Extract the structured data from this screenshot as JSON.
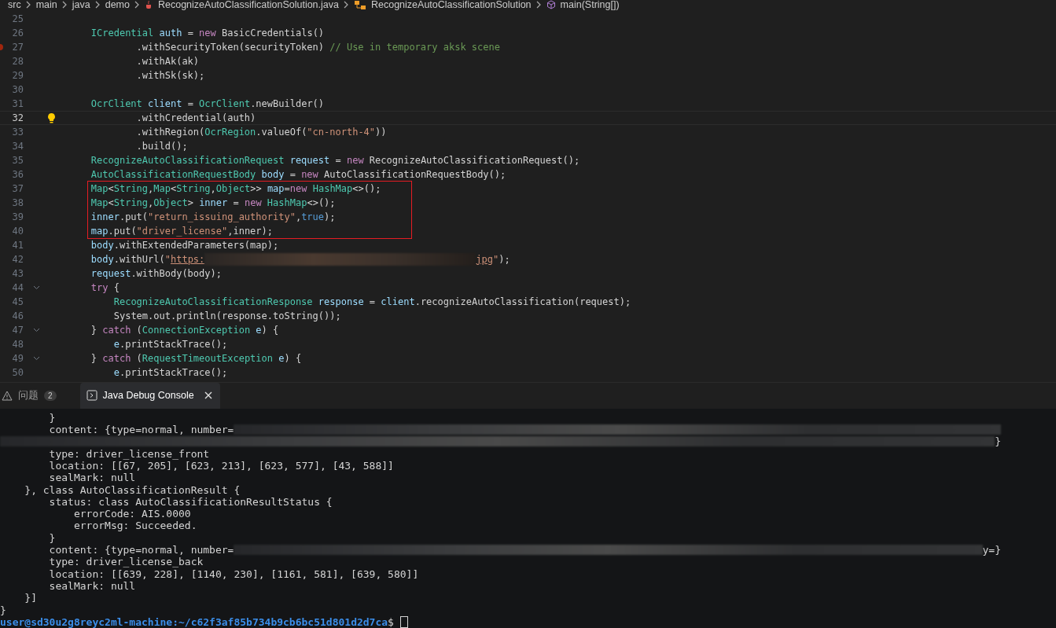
{
  "breadcrumb": [
    {
      "kind": "folder",
      "label": "src"
    },
    {
      "kind": "folder",
      "label": "main"
    },
    {
      "kind": "folder",
      "label": "java"
    },
    {
      "kind": "folder",
      "label": "demo"
    },
    {
      "kind": "file",
      "label": "RecognizeAutoClassificationSolution.java"
    },
    {
      "kind": "class",
      "label": "RecognizeAutoClassificationSolution"
    },
    {
      "kind": "method",
      "label": "main(String[])"
    }
  ],
  "editor": {
    "lines": [
      {
        "kind": "line",
        "number": "25",
        "current": false
      },
      {
        "kind": "line",
        "number": "26",
        "current": false,
        "tokens": [
          {
            "kind": "type",
            "text": "        ICredential"
          },
          {
            "kind": "var",
            "text": " auth"
          },
          {
            "kind": "plain",
            "text": " = "
          },
          {
            "kind": "keyword",
            "text": "new"
          },
          {
            "kind": "plain",
            "text": " BasicCredentials()"
          }
        ]
      },
      {
        "kind": "breakpoint",
        "number": "27",
        "current": false,
        "tokens": [
          {
            "kind": "plain",
            "text": "                .withSecurityToken(securityToken) "
          },
          {
            "kind": "comment",
            "text": "// Use in temporary aksk scene"
          }
        ]
      },
      {
        "kind": "line",
        "number": "28",
        "current": false,
        "tokens": [
          {
            "kind": "plain",
            "text": "                .withAk(ak)"
          }
        ]
      },
      {
        "kind": "line",
        "number": "29",
        "current": false,
        "tokens": [
          {
            "kind": "plain",
            "text": "                .withSk(sk);"
          }
        ]
      },
      {
        "kind": "line",
        "number": "30",
        "current": false
      },
      {
        "kind": "line",
        "number": "31",
        "current": false,
        "tokens": [
          {
            "kind": "type",
            "text": "        OcrClient"
          },
          {
            "kind": "var",
            "text": " client"
          },
          {
            "kind": "plain",
            "text": " = "
          },
          {
            "kind": "type",
            "text": "OcrClient"
          },
          {
            "kind": "plain",
            "text": ".newBuilder()"
          }
        ]
      },
      {
        "kind": "lightbulb",
        "number": "32",
        "current": true,
        "tokens": [
          {
            "kind": "plain",
            "text": "                .withCredential(auth)"
          }
        ]
      },
      {
        "kind": "line",
        "number": "33",
        "current": false,
        "tokens": [
          {
            "kind": "plain",
            "text": "                .withRegion("
          },
          {
            "kind": "type",
            "text": "OcrRegion"
          },
          {
            "kind": "plain",
            "text": ".valueOf("
          },
          {
            "kind": "string",
            "text": "\"cn-north-4\""
          },
          {
            "kind": "plain",
            "text": "))"
          }
        ]
      },
      {
        "kind": "line",
        "number": "34",
        "current": false,
        "tokens": [
          {
            "kind": "plain",
            "text": "                .build();"
          }
        ]
      },
      {
        "kind": "line",
        "number": "35",
        "current": false,
        "tokens": [
          {
            "kind": "type",
            "text": "        RecognizeAutoClassificationRequest"
          },
          {
            "kind": "var",
            "text": " request"
          },
          {
            "kind": "plain",
            "text": " = "
          },
          {
            "kind": "keyword",
            "text": "new"
          },
          {
            "kind": "plain",
            "text": " RecognizeAutoClassificationRequest();"
          }
        ]
      },
      {
        "kind": "line",
        "number": "36",
        "current": false,
        "tokens": [
          {
            "kind": "type",
            "text": "        AutoClassificationRequestBody"
          },
          {
            "kind": "var",
            "text": " body"
          },
          {
            "kind": "plain",
            "text": " = "
          },
          {
            "kind": "keyword",
            "text": "new"
          },
          {
            "kind": "plain",
            "text": " AutoClassificationRequestBody();"
          }
        ]
      },
      {
        "kind": "box",
        "lines": [
          {
            "kind": "line",
            "number": "37",
            "current": false,
            "tokens": [
              {
                "kind": "type",
                "text": "        Map"
              },
              {
                "kind": "plain",
                "text": "<"
              },
              {
                "kind": "type",
                "text": "String"
              },
              {
                "kind": "plain",
                "text": ","
              },
              {
                "kind": "type",
                "text": "Map"
              },
              {
                "kind": "plain",
                "text": "<"
              },
              {
                "kind": "type",
                "text": "String"
              },
              {
                "kind": "plain",
                "text": ","
              },
              {
                "kind": "type",
                "text": "Object"
              },
              {
                "kind": "plain",
                "text": ">> "
              },
              {
                "kind": "var",
                "text": "map"
              },
              {
                "kind": "plain",
                "text": "="
              },
              {
                "kind": "keyword",
                "text": "new"
              },
              {
                "kind": "type",
                "text": " HashMap"
              },
              {
                "kind": "plain",
                "text": "<>();"
              }
            ]
          },
          {
            "kind": "line",
            "number": "38",
            "current": false,
            "tokens": [
              {
                "kind": "type",
                "text": "        Map"
              },
              {
                "kind": "plain",
                "text": "<"
              },
              {
                "kind": "type",
                "text": "String"
              },
              {
                "kind": "plain",
                "text": ","
              },
              {
                "kind": "type",
                "text": "Object"
              },
              {
                "kind": "plain",
                "text": "> "
              },
              {
                "kind": "var",
                "text": "inner"
              },
              {
                "kind": "plain",
                "text": " = "
              },
              {
                "kind": "keyword",
                "text": "new"
              },
              {
                "kind": "type",
                "text": " HashMap"
              },
              {
                "kind": "plain",
                "text": "<>();"
              }
            ]
          },
          {
            "kind": "line",
            "number": "39",
            "current": false,
            "tokens": [
              {
                "kind": "var",
                "text": "        inner"
              },
              {
                "kind": "plain",
                "text": ".put("
              },
              {
                "kind": "string",
                "text": "\"return_issuing_authority\""
              },
              {
                "kind": "plain",
                "text": ","
              },
              {
                "kind": "literal",
                "text": "true"
              },
              {
                "kind": "plain",
                "text": ");"
              }
            ]
          },
          {
            "kind": "line",
            "number": "40",
            "current": false,
            "tokens": [
              {
                "kind": "var",
                "text": "        map"
              },
              {
                "kind": "plain",
                "text": ".put("
              },
              {
                "kind": "string",
                "text": "\"driver_license\""
              },
              {
                "kind": "plain",
                "text": ",inner);"
              }
            ]
          }
        ]
      },
      {
        "kind": "line",
        "number": "41",
        "current": false,
        "tokens": [
          {
            "kind": "var",
            "text": "        body"
          },
          {
            "kind": "plain",
            "text": ".withExtendedParameters(map);"
          }
        ]
      },
      {
        "kind": "line",
        "number": "42",
        "current": false,
        "tokens": [
          {
            "kind": "var",
            "text": "        body"
          },
          {
            "kind": "plain",
            "text": ".withUrl("
          },
          {
            "kind": "string",
            "text": "\""
          },
          {
            "kind": "link",
            "text": "https:"
          },
          {
            "kind": "redacted"
          },
          {
            "kind": "link",
            "text": "jpg"
          },
          {
            "kind": "string",
            "text": "\""
          },
          {
            "kind": "plain",
            "text": ");"
          }
        ]
      },
      {
        "kind": "line",
        "number": "43",
        "current": false,
        "tokens": [
          {
            "kind": "var",
            "text": "        request"
          },
          {
            "kind": "plain",
            "text": ".withBody(body);"
          }
        ]
      },
      {
        "kind": "fold",
        "number": "44",
        "current": false,
        "tokens": [
          {
            "kind": "keyword",
            "text": "        try"
          },
          {
            "kind": "plain",
            "text": " {"
          }
        ]
      },
      {
        "kind": "line",
        "number": "45",
        "current": false,
        "tokens": [
          {
            "kind": "type",
            "text": "            RecognizeAutoClassificationResponse"
          },
          {
            "kind": "var",
            "text": " response"
          },
          {
            "kind": "plain",
            "text": " = "
          },
          {
            "kind": "var",
            "text": "client"
          },
          {
            "kind": "plain",
            "text": ".recognizeAutoClassification(request);"
          }
        ]
      },
      {
        "kind": "line",
        "number": "46",
        "current": false,
        "tokens": [
          {
            "kind": "plain",
            "text": "            System.out.println(response.toString());"
          }
        ]
      },
      {
        "kind": "fold",
        "number": "47",
        "current": false,
        "tokens": [
          {
            "kind": "plain",
            "text": "        } "
          },
          {
            "kind": "keyword",
            "text": "catch"
          },
          {
            "kind": "plain",
            "text": " ("
          },
          {
            "kind": "type",
            "text": "ConnectionException"
          },
          {
            "kind": "var",
            "text": " e"
          },
          {
            "kind": "plain",
            "text": ") {"
          }
        ]
      },
      {
        "kind": "line",
        "number": "48",
        "current": false,
        "tokens": [
          {
            "kind": "var",
            "text": "            e"
          },
          {
            "kind": "plain",
            "text": ".printStackTrace();"
          }
        ]
      },
      {
        "kind": "fold",
        "number": "49",
        "current": false,
        "tokens": [
          {
            "kind": "plain",
            "text": "        } "
          },
          {
            "kind": "keyword",
            "text": "catch"
          },
          {
            "kind": "plain",
            "text": " ("
          },
          {
            "kind": "type",
            "text": "RequestTimeoutException"
          },
          {
            "kind": "var",
            "text": " e"
          },
          {
            "kind": "plain",
            "text": ") {"
          }
        ]
      },
      {
        "kind": "line",
        "number": "50",
        "current": false,
        "tokens": [
          {
            "kind": "var",
            "text": "            e"
          },
          {
            "kind": "plain",
            "text": ".printStackTrace();"
          }
        ]
      }
    ]
  },
  "panel": {
    "tabs": [
      {
        "kind": "problems",
        "label": "问题",
        "badge": "2",
        "selected": false
      },
      {
        "kind": "console",
        "label": "Java Debug Console",
        "selected": true
      }
    ],
    "console": [
      {
        "kind": "output",
        "tokens": [
          {
            "kind": "text",
            "text": "        }"
          }
        ]
      },
      {
        "kind": "output",
        "tokens": [
          {
            "kind": "text",
            "text": "        content: {type=normal, number="
          },
          {
            "kind": "redacted"
          }
        ]
      },
      {
        "kind": "output",
        "tokens": [
          {
            "kind": "redacted"
          },
          {
            "kind": "text",
            "text": "}"
          }
        ]
      },
      {
        "kind": "output",
        "tokens": [
          {
            "kind": "text",
            "text": "        type: driver_license_front"
          }
        ]
      },
      {
        "kind": "output",
        "tokens": [
          {
            "kind": "text",
            "text": "        location: [[67, 205], [623, 213], [623, 577], [43, 588]]"
          }
        ]
      },
      {
        "kind": "output",
        "tokens": [
          {
            "kind": "text",
            "text": "        sealMark: null"
          }
        ]
      },
      {
        "kind": "output",
        "tokens": [
          {
            "kind": "text",
            "text": "    }, class AutoClassificationResult {"
          }
        ]
      },
      {
        "kind": "output",
        "tokens": [
          {
            "kind": "text",
            "text": "        status: class AutoClassificationResultStatus {"
          }
        ]
      },
      {
        "kind": "output",
        "tokens": [
          {
            "kind": "text",
            "text": "            errorCode: AIS.0000"
          }
        ]
      },
      {
        "kind": "output",
        "tokens": [
          {
            "kind": "text",
            "text": "            errorMsg: Succeeded."
          }
        ]
      },
      {
        "kind": "output",
        "tokens": [
          {
            "kind": "text",
            "text": "        }"
          }
        ]
      },
      {
        "kind": "output",
        "tokens": [
          {
            "kind": "text",
            "text": "        content: {type=normal, number="
          },
          {
            "kind": "redacted"
          },
          {
            "kind": "text",
            "text": "y=}"
          }
        ]
      },
      {
        "kind": "output",
        "tokens": [
          {
            "kind": "text",
            "text": "        type: driver_license_back"
          }
        ]
      },
      {
        "kind": "output",
        "tokens": [
          {
            "kind": "text",
            "text": "        location: [[639, 228], [1140, 230], [1161, 581], [639, 580]]"
          }
        ]
      },
      {
        "kind": "output",
        "tokens": [
          {
            "kind": "text",
            "text": "        sealMark: null"
          }
        ]
      },
      {
        "kind": "output",
        "tokens": [
          {
            "kind": "text",
            "text": "    }]"
          }
        ]
      },
      {
        "kind": "output",
        "tokens": [
          {
            "kind": "text",
            "text": "}"
          }
        ]
      },
      {
        "kind": "prompt",
        "user": "user@sd30u2g8reyc2ml-machine",
        "path": ":~/c62f3af85b734b9cb6bc51d801d2d7ca",
        "symbol": "$"
      }
    ]
  }
}
